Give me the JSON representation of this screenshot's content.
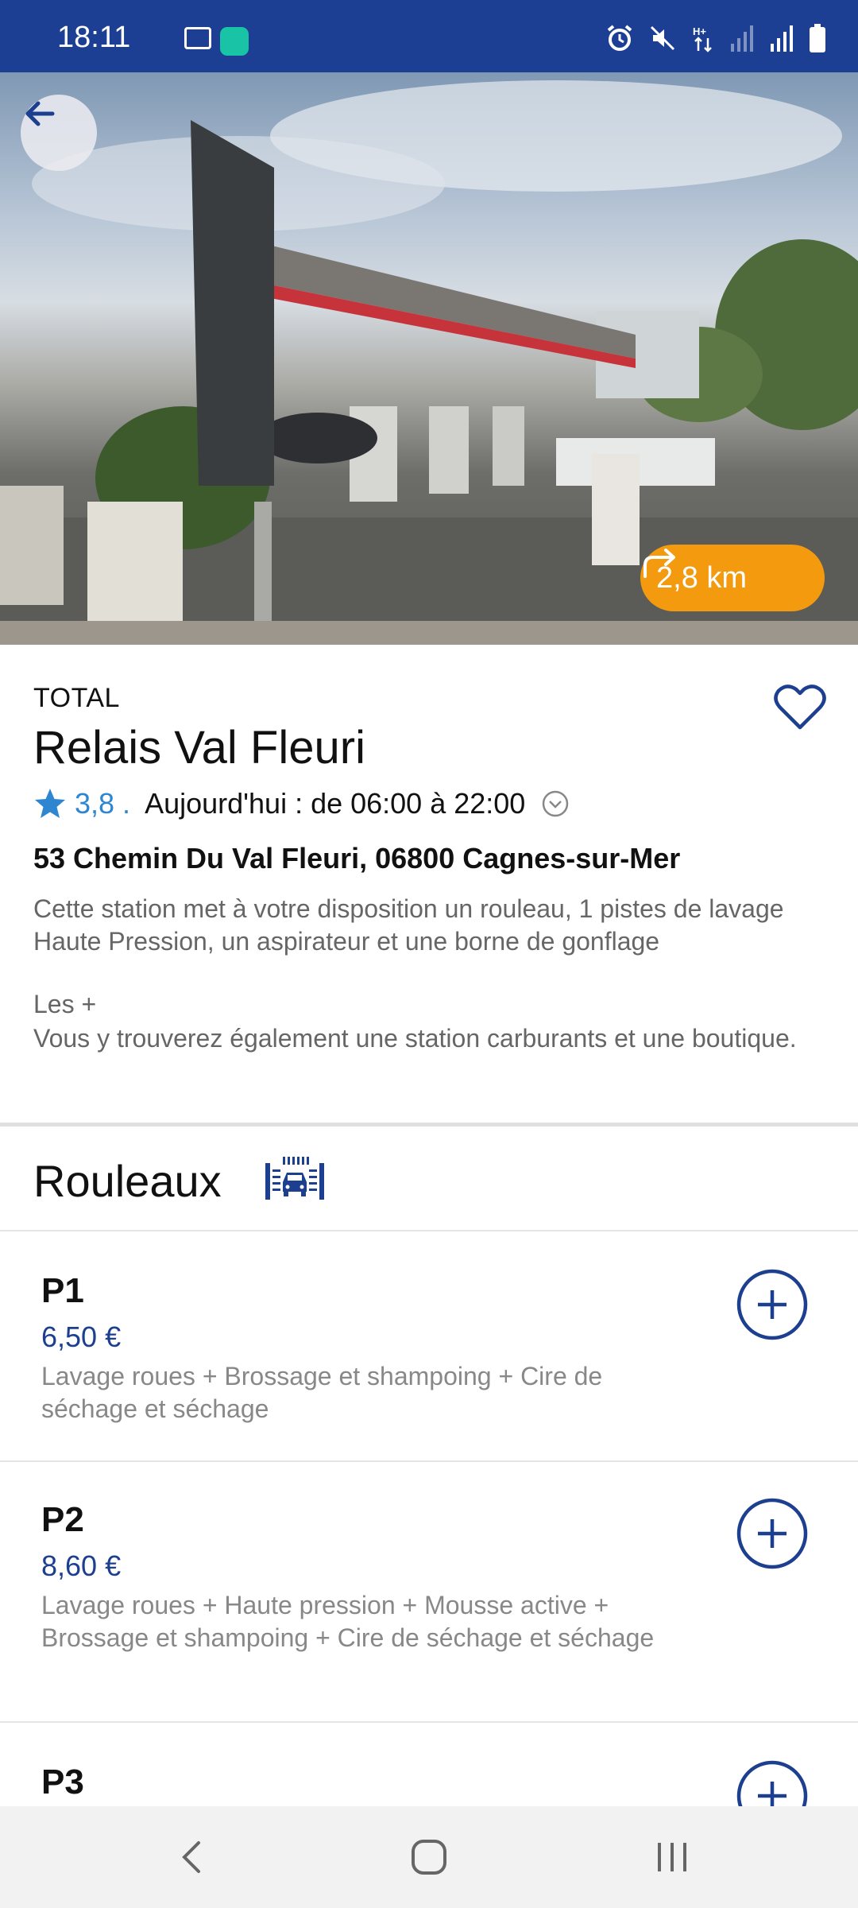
{
  "status_bar": {
    "time": "18:11",
    "left_icons": [
      "gallery-icon",
      "app-notification-icon"
    ],
    "right_icons": [
      "alarm-icon",
      "mute-icon",
      "data-hplus-icon",
      "signal-icon",
      "signal-icon",
      "battery-icon"
    ]
  },
  "hero": {
    "image": "photo-of-total-station",
    "distance": "2,8 km",
    "colors": {
      "pill": "#f39a0f"
    }
  },
  "station": {
    "brand": "TOTAL",
    "name": "Relais Val Fleuri",
    "rating": "3,8",
    "separator": ".",
    "hours": "Aujourd'hui : de 06:00 à 22:00",
    "address": "53 Chemin Du Val Fleuri, 06800 Cagnes-sur-Mer",
    "description": "Cette station met à votre disposition un rouleau,  1 pistes de lavage Haute Pression, un aspirateur et une borne de gonflage",
    "extras_title": "Les +",
    "extras_text": "Vous y trouverez également une station carburants et une boutique."
  },
  "section": {
    "title": "Rouleaux",
    "icon": "car-wash-icon"
  },
  "products": [
    {
      "name": "P1",
      "price": "6,50 €",
      "description": "Lavage roues + Brossage et shampoing + Cire de séchage et séchage"
    },
    {
      "name": "P2",
      "price": "8,60 €",
      "description": "Lavage roues + Haute pression + Mousse active + Brossage et shampoing + Cire de séchage et séchage"
    },
    {
      "name": "P3",
      "price": "",
      "description": ""
    }
  ],
  "colors": {
    "status_bar": "#1c3f94",
    "accent_blue": "#1d3f8f",
    "rating_blue": "#2e86d1",
    "orange": "#f39a0f"
  }
}
